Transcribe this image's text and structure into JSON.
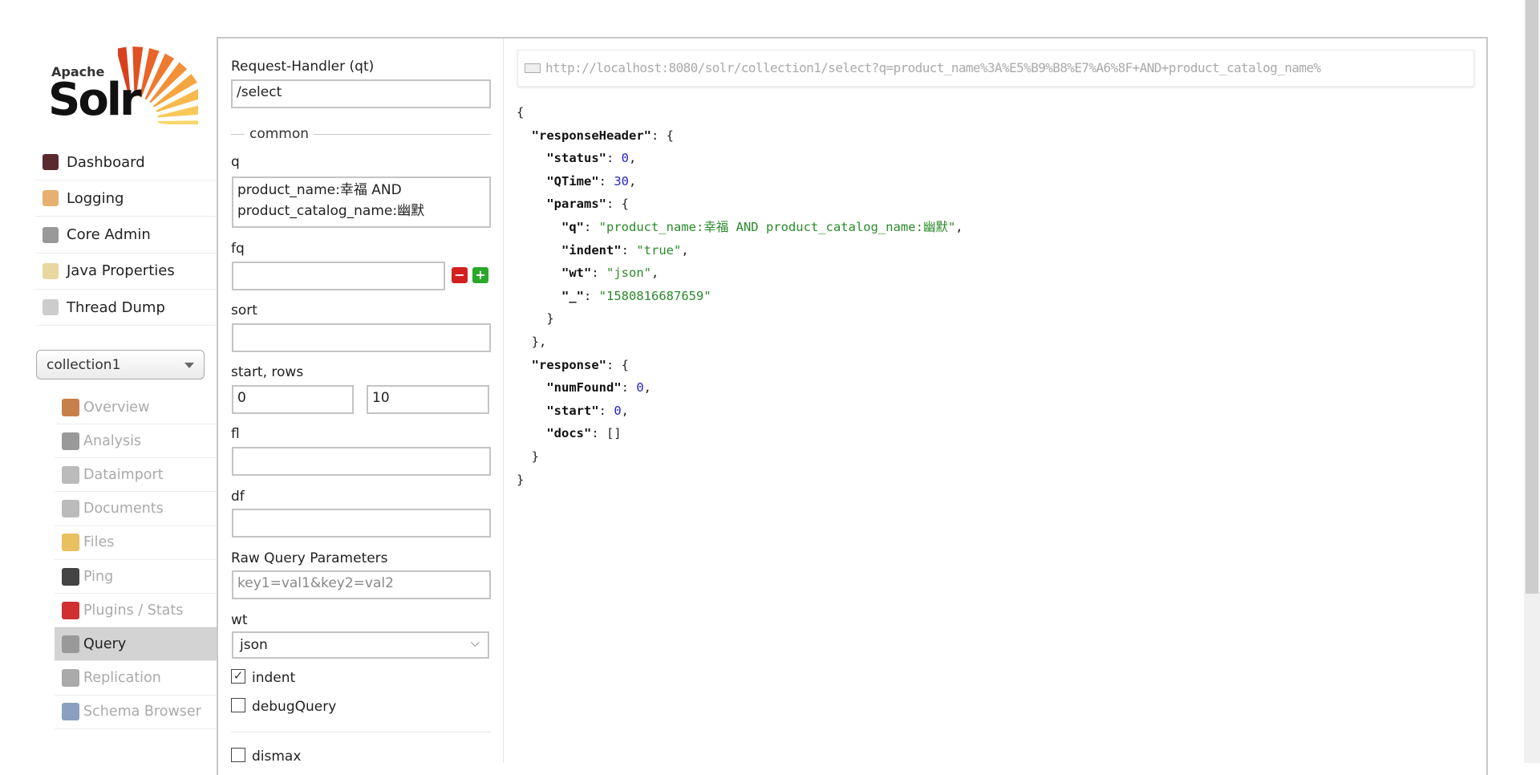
{
  "logo": {
    "line1": "Apache",
    "line2": "Solr"
  },
  "main_menu": [
    {
      "label": "Dashboard",
      "icon": "dashboard-icon",
      "color": "#5a2a30"
    },
    {
      "label": "Logging",
      "icon": "logging-icon",
      "color": "#e8b070"
    },
    {
      "label": "Core Admin",
      "icon": "core-admin-icon",
      "color": "#999999"
    },
    {
      "label": "Java Properties",
      "icon": "java-properties-icon",
      "color": "#e8d8a0"
    },
    {
      "label": "Thread Dump",
      "icon": "thread-dump-icon",
      "color": "#cccccc"
    }
  ],
  "core_selector": {
    "value": "collection1"
  },
  "core_menu": [
    {
      "label": "Overview",
      "icon": "home-icon",
      "color": "#c8804a"
    },
    {
      "label": "Analysis",
      "icon": "funnel-icon",
      "color": "#999999"
    },
    {
      "label": "Dataimport",
      "icon": "dataimport-icon",
      "color": "#bbbbbb"
    },
    {
      "label": "Documents",
      "icon": "documents-icon",
      "color": "#bbbbbb"
    },
    {
      "label": "Files",
      "icon": "folder-icon",
      "color": "#e8c060"
    },
    {
      "label": "Ping",
      "icon": "ping-icon",
      "color": "#444444"
    },
    {
      "label": "Plugins / Stats",
      "icon": "plugins-icon",
      "color": "#d03030"
    },
    {
      "label": "Query",
      "icon": "magnifier-icon",
      "color": "#999999"
    },
    {
      "label": "Replication",
      "icon": "replication-icon",
      "color": "#aaaaaa"
    },
    {
      "label": "Schema Browser",
      "icon": "schema-browser-icon",
      "color": "#8aa0c0"
    }
  ],
  "form": {
    "qt_label": "Request-Handler (qt)",
    "qt_value": "/select",
    "common_legend": "common",
    "q_label": "q",
    "q_value": "product_name:幸福 AND product_catalog_name:幽默",
    "fq_label": "fq",
    "fq_value": "",
    "sort_label": "sort",
    "start_rows_label": "start, rows",
    "start_value": "0",
    "rows_value": "10",
    "fl_label": "fl",
    "df_label": "df",
    "raw_label": "Raw Query Parameters",
    "raw_placeholder": "key1=val1&key2=val2",
    "wt_label": "wt",
    "wt_value": "json",
    "indent_label": "indent",
    "indent_checked": true,
    "debug_label": "debugQuery",
    "debug_checked": false,
    "dismax_label": "dismax",
    "dismax_checked": false
  },
  "url": "http://localhost:8080/solr/collection1/select?q=product_name%3A%E5%B9%B8%E7%A6%8F+AND+product_catalog_name%",
  "response_lines": [
    [
      0,
      [
        [
          "p",
          "{"
        ]
      ]
    ],
    [
      1,
      [
        [
          "k",
          "\"responseHeader\""
        ],
        [
          "p",
          ": {"
        ]
      ]
    ],
    [
      2,
      [
        [
          "k",
          "\"status\""
        ],
        [
          "p",
          ": "
        ],
        [
          "n",
          "0"
        ],
        [
          "p",
          ","
        ]
      ]
    ],
    [
      2,
      [
        [
          "k",
          "\"QTime\""
        ],
        [
          "p",
          ": "
        ],
        [
          "n",
          "30"
        ],
        [
          "p",
          ","
        ]
      ]
    ],
    [
      2,
      [
        [
          "k",
          "\"params\""
        ],
        [
          "p",
          ": {"
        ]
      ]
    ],
    [
      3,
      [
        [
          "k",
          "\"q\""
        ],
        [
          "p",
          ": "
        ],
        [
          "s",
          "\"product_name:幸福 AND product_catalog_name:幽默\""
        ],
        [
          "p",
          ","
        ]
      ]
    ],
    [
      3,
      [
        [
          "k",
          "\"indent\""
        ],
        [
          "p",
          ": "
        ],
        [
          "s",
          "\"true\""
        ],
        [
          "p",
          ","
        ]
      ]
    ],
    [
      3,
      [
        [
          "k",
          "\"wt\""
        ],
        [
          "p",
          ": "
        ],
        [
          "s",
          "\"json\""
        ],
        [
          "p",
          ","
        ]
      ]
    ],
    [
      3,
      [
        [
          "k",
          "\"_\""
        ],
        [
          "p",
          ": "
        ],
        [
          "s",
          "\"1580816687659\""
        ]
      ]
    ],
    [
      2,
      [
        [
          "p",
          "}"
        ]
      ]
    ],
    [
      1,
      [
        [
          "p",
          "},"
        ]
      ]
    ],
    [
      1,
      [
        [
          "k",
          "\"response\""
        ],
        [
          "p",
          ": {"
        ]
      ]
    ],
    [
      2,
      [
        [
          "k",
          "\"numFound\""
        ],
        [
          "p",
          ": "
        ],
        [
          "n",
          "0"
        ],
        [
          "p",
          ","
        ]
      ]
    ],
    [
      2,
      [
        [
          "k",
          "\"start\""
        ],
        [
          "p",
          ": "
        ],
        [
          "n",
          "0"
        ],
        [
          "p",
          ","
        ]
      ]
    ],
    [
      2,
      [
        [
          "k",
          "\"docs\""
        ],
        [
          "p",
          ": []"
        ]
      ]
    ],
    [
      1,
      [
        [
          "p",
          "}"
        ]
      ]
    ],
    [
      0,
      [
        [
          "p",
          "}"
        ]
      ]
    ]
  ]
}
